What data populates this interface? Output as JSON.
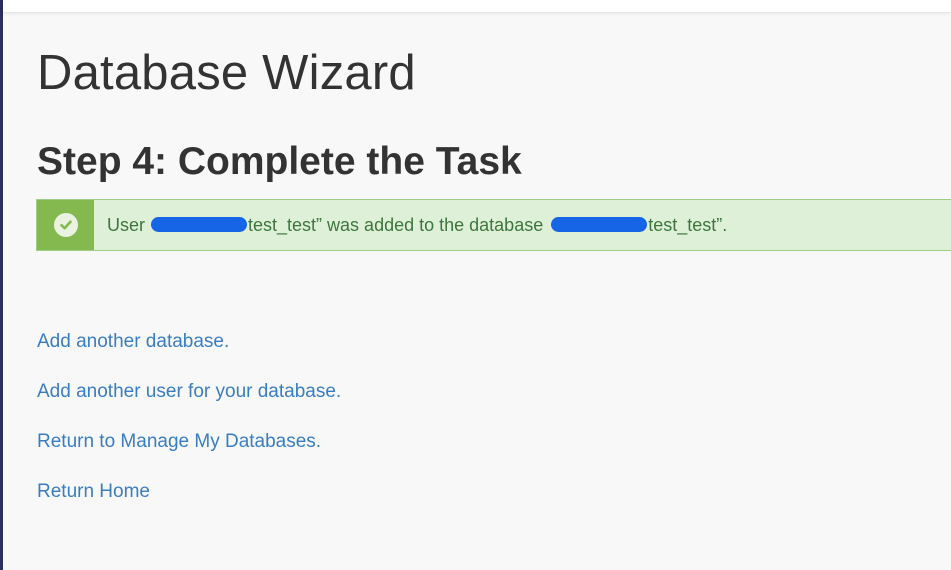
{
  "page": {
    "title": "Database Wizard",
    "step_title": "Step 4: Complete the Task"
  },
  "alert": {
    "type": "success",
    "icon": "check-circle-icon",
    "color_bg": "#dff0d8",
    "color_icon_bg": "#83b94f",
    "color_text": "#3c763d",
    "text_prefix": "User ",
    "user_suffix": "test_test” was added to the database ",
    "database_suffix": "test_test”."
  },
  "links": {
    "add_database": "Add another database.",
    "add_user": "Add another user for your database.",
    "manage_databases": "Return to Manage My Databases.",
    "return_home": "Return Home"
  }
}
